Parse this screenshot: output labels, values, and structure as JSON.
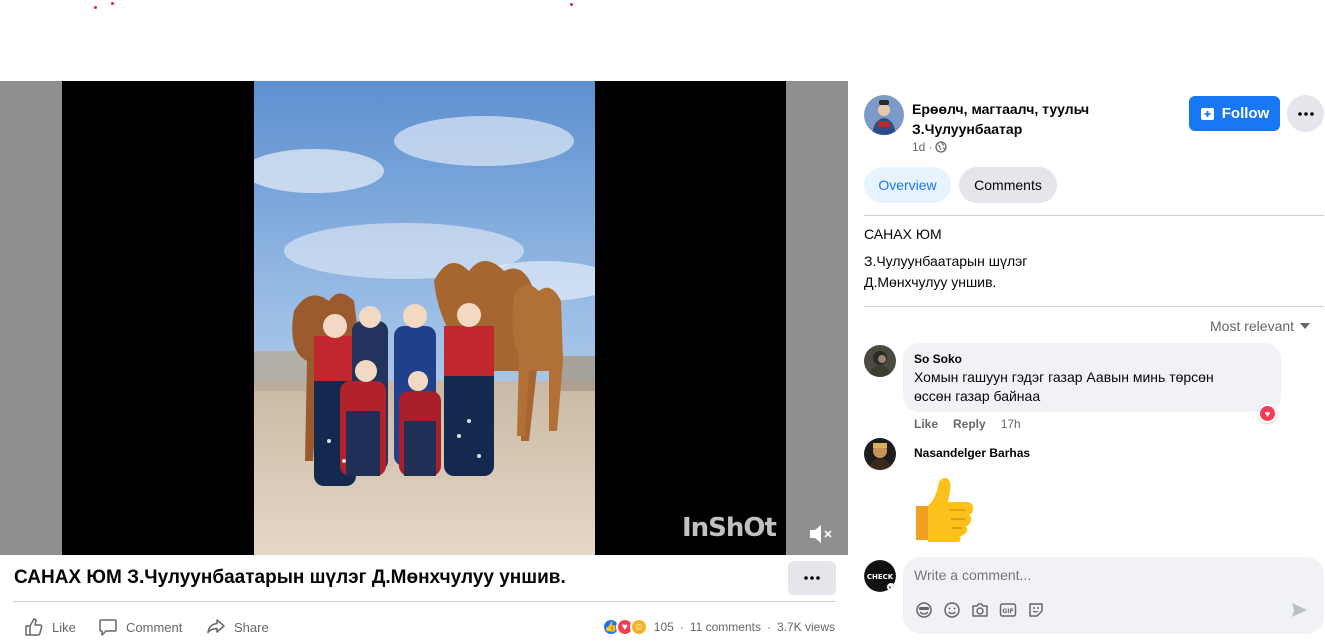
{
  "video": {
    "watermark": "InShOt"
  },
  "post": {
    "title": "САНАХ ЮМ З.Чулуунбаатарын шүлэг Д.Мөнхчулуу уншив.",
    "actions": {
      "like": "Like",
      "comment": "Comment",
      "share": "Share"
    },
    "stats": {
      "reactions": "105",
      "comments": "11 comments",
      "views": "3.7K views"
    }
  },
  "page": {
    "name_line1": "Ерөөлч, магтаалч, туульч",
    "name_line2": "З.Чулуунбаатар",
    "time": "1d",
    "follow_label": "Follow"
  },
  "tabs": {
    "overview": "Overview",
    "comments": "Comments"
  },
  "description": {
    "line1": "САНАХ ЮМ",
    "line2": "З.Чулуунбаатарын шүлэг",
    "line3": "Д.Мөнхчулуу уншив."
  },
  "sort_label": "Most relevant",
  "comments": [
    {
      "author": "So Soko",
      "text_line1": "Хомын гашуун гэдэг газар Аавын минь төрсөн",
      "text_line2": "өссөн газар байнаа",
      "like": "Like",
      "reply": "Reply",
      "time": "17h"
    },
    {
      "author": "Nasandelger Barhas"
    }
  ],
  "composer": {
    "placeholder": "Write a comment..."
  },
  "colors": {
    "accent": "#1877f2",
    "muted": "#65676b",
    "bubble": "#f0f2f5",
    "love": "#f33e58"
  }
}
